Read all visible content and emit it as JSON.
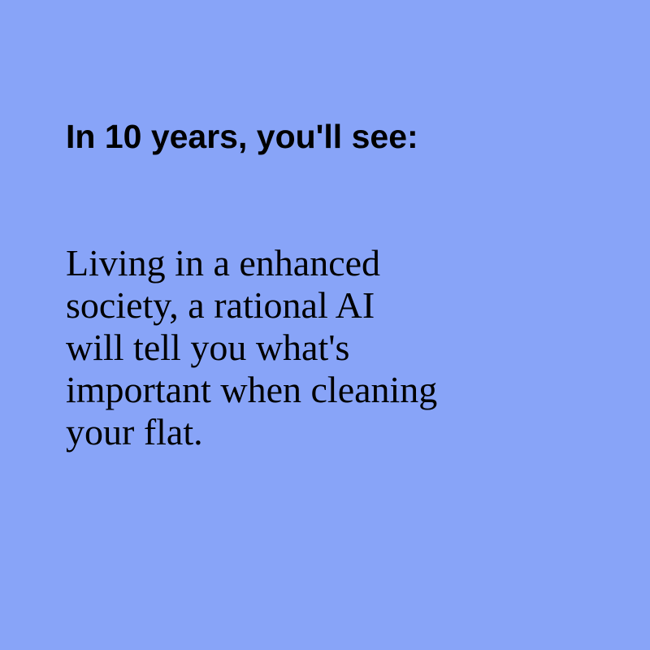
{
  "heading": "In 10 years, you'll see:",
  "body_lines": [
    "Living in a enhanced",
    "society, a rational AI",
    "will tell you what's",
    "important when cleaning",
    "your flat."
  ],
  "colors": {
    "background": "#88a4f8",
    "text": "#000000"
  }
}
